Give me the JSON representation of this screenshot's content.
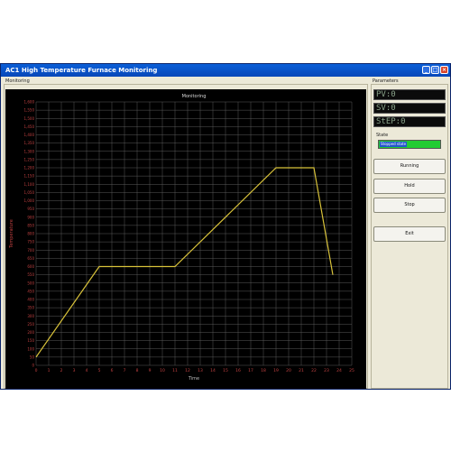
{
  "window": {
    "title": "AC1 High Temperature Furnace Monitoring",
    "controls": {
      "minimize": "_",
      "maximize": "□",
      "close": "×"
    }
  },
  "monitoring": {
    "group_label": "Monitoring",
    "chart_data": {
      "type": "line",
      "title": "Monitoring",
      "xlabel": "Time",
      "ylabel": "Temperature",
      "x_ticks": [
        "0",
        "1",
        "2",
        "3",
        "4",
        "5",
        "6",
        "7",
        "8",
        "9",
        "10",
        "11",
        "12",
        "13",
        "14",
        "15",
        "16",
        "17",
        "18",
        "19",
        "20",
        "21",
        "22",
        "23",
        "24",
        "25"
      ],
      "y_ticks": [
        "1,600",
        "1,550",
        "1,500",
        "1,450",
        "1,400",
        "1,350",
        "1,300",
        "1,250",
        "1,200",
        "1,150",
        "1,100",
        "1,050",
        "1,000",
        "950",
        "900",
        "850",
        "800",
        "750",
        "700",
        "650",
        "600",
        "550",
        "500",
        "450",
        "400",
        "350",
        "300",
        "250",
        "200",
        "150",
        "100",
        "50",
        "0"
      ],
      "xlim": [
        0,
        25
      ],
      "ylim": [
        0,
        1600
      ],
      "grid": true,
      "series": [
        {
          "color": "#d8c23a",
          "x": [
            0,
            5,
            11,
            19,
            22,
            23.5
          ],
          "y": [
            50,
            600,
            600,
            1200,
            1200,
            550
          ]
        }
      ]
    }
  },
  "parameters": {
    "group_label": "Parameters",
    "pv": "PV:0",
    "sv": "SV:0",
    "step": "StEP:0",
    "state_label": "State",
    "state_value": "Stopped state",
    "state_color": "#22cc33",
    "buttons": {
      "running": "Running",
      "hold": "Hold",
      "stop": "Stop",
      "exit": "Exit"
    }
  }
}
